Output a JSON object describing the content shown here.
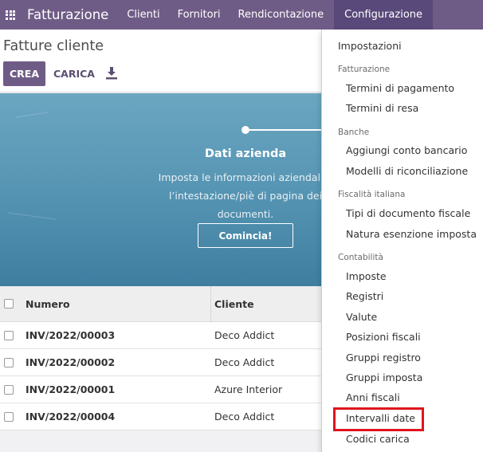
{
  "navbar": {
    "app_name": "Fatturazione",
    "menu": [
      "Clienti",
      "Fornitori",
      "Rendicontazione",
      "Configurazione"
    ],
    "active": "Configurazione"
  },
  "control": {
    "breadcrumb": "Fatture cliente",
    "create_label": "CREA",
    "upload_label": "CARICA"
  },
  "banner": {
    "title": "Dati azienda",
    "description": "Imposta le informazioni aziendali p l’intestazione/piè di pagina dei documenti.",
    "desc_lines": [
      "Imposta le informazioni aziendali p",
      "l’intestazione/piè di pagina dei",
      "documenti."
    ],
    "button_label": "Comincia!"
  },
  "table": {
    "headers": [
      "Numero",
      "Cliente"
    ],
    "rows": [
      {
        "numero": "INV/2022/00003",
        "cliente": "Deco Addict"
      },
      {
        "numero": "INV/2022/00002",
        "cliente": "Deco Addict"
      },
      {
        "numero": "INV/2022/00001",
        "cliente": "Azure Interior"
      },
      {
        "numero": "INV/2022/00004",
        "cliente": "Deco Addict"
      }
    ]
  },
  "dropdown": {
    "settings": "Impostazioni",
    "sections": [
      {
        "header": "Fatturazione",
        "items": [
          "Termini di pagamento",
          "Termini di resa"
        ]
      },
      {
        "header": "Banche",
        "items": [
          "Aggiungi conto bancario",
          "Modelli di riconciliazione"
        ]
      },
      {
        "header": "Fiscalità italiana",
        "items": [
          "Tipi di documento fiscale",
          "Natura esenzione imposta"
        ]
      },
      {
        "header": "Contabilità",
        "items": [
          "Imposte",
          "Registri",
          "Valute",
          "Posizioni fiscali",
          "Gruppi registro",
          "Gruppi imposta",
          "Anni fiscali",
          "Intervalli date",
          "Codici carica"
        ]
      }
    ],
    "highlighted_item": "Intervalli date"
  },
  "colors": {
    "brand": "#6f5c86",
    "highlight": "#e0141e"
  }
}
